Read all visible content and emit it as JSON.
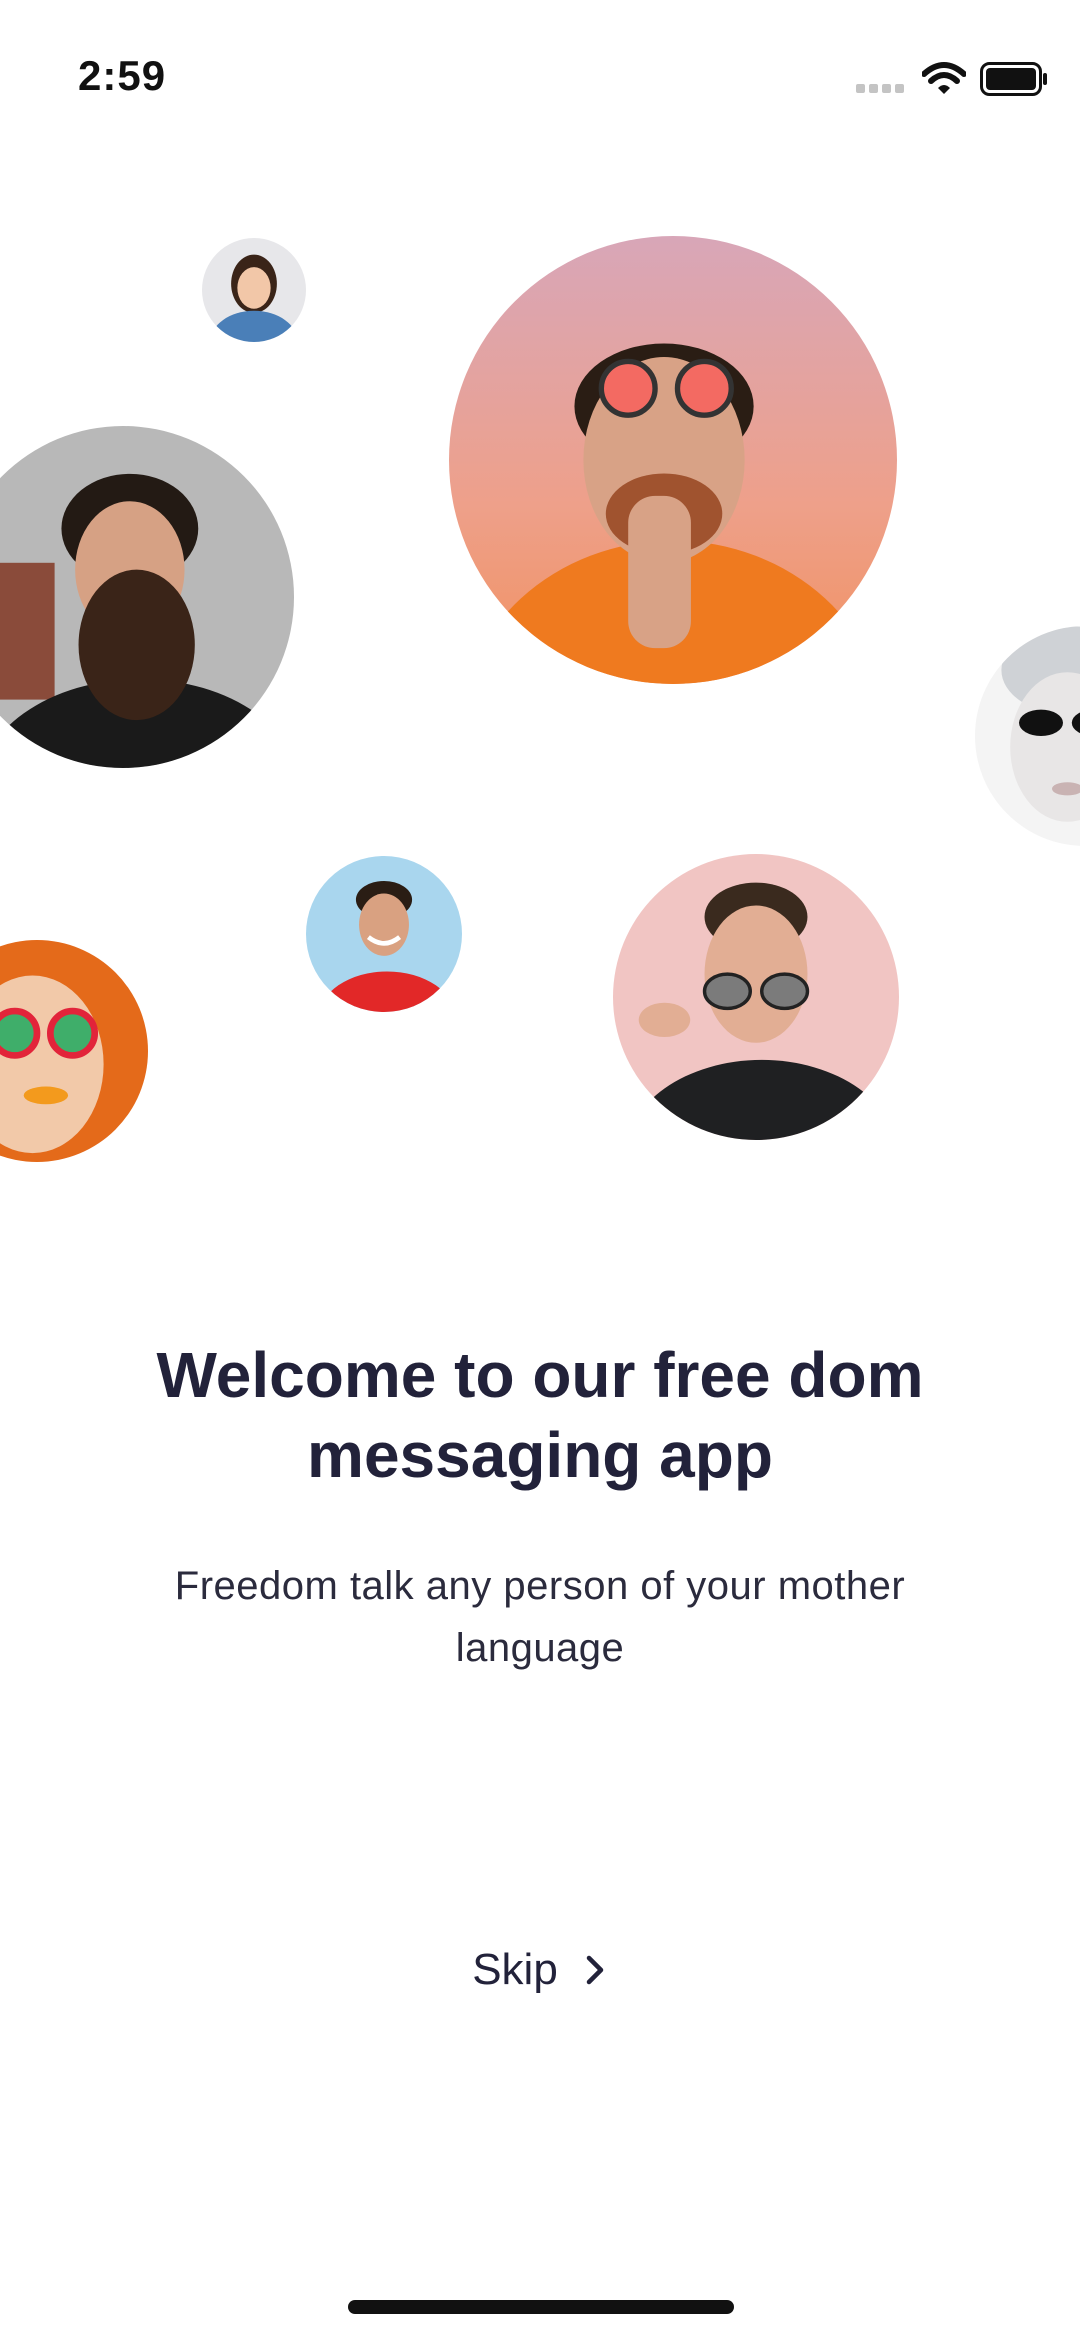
{
  "status_bar": {
    "time": "2:59",
    "icons": [
      "signal-icon",
      "wifi-icon",
      "battery-icon"
    ]
  },
  "avatars": [
    {
      "name": "avatar-small-woman",
      "bg": "#e7e7ea",
      "shirt": "#4a7fb8",
      "hair": "#3a2418",
      "skin": "#f2c7a8"
    },
    {
      "name": "avatar-mac-miller-large",
      "bg": "#e6a296",
      "shirt": "#ef7a1f",
      "hair": "#2a1d14",
      "skin": "#d8a286"
    },
    {
      "name": "avatar-bearded-man",
      "bg": "#b8b8b8",
      "shirt": "#1a1a1a",
      "hair": "#231a14",
      "skin": "#d6a184"
    },
    {
      "name": "avatar-face-paint",
      "bg": "#f4f4f4",
      "shirt": "#e9e9ee",
      "hair": "#cfd2d6",
      "skin": "#e8e6e6"
    },
    {
      "name": "avatar-smiling-man",
      "bg": "#a9d6ee",
      "shirt": "#e22828",
      "hair": "#2a1d14",
      "skin": "#d9a181"
    },
    {
      "name": "avatar-colorful-woman",
      "bg": "#e46a1a",
      "shirt": "#f08a2a",
      "hair": "#e0581a",
      "skin": "#f2c9a9"
    },
    {
      "name": "avatar-mac-miller-glasses",
      "bg": "#f1c5c3",
      "shirt": "#1f2022",
      "hair": "#3a2a1e",
      "skin": "#e2ae94"
    }
  ],
  "welcome": {
    "title": "Welcome to our free dom messaging app",
    "subtitle": "Freedom talk any person of your mother language"
  },
  "skip": {
    "label": "Skip"
  },
  "colors": {
    "text_primary": "#22223a",
    "background": "#ffffff"
  }
}
